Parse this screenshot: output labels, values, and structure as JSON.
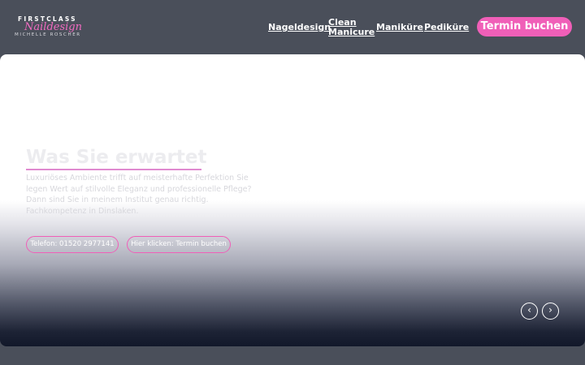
{
  "logo": {
    "line1": "FIRSTCLASS",
    "line2": "Naildesign",
    "line3": "MICHELLE ROSCHER"
  },
  "nav": {
    "items": [
      {
        "label": "Nageldesign"
      },
      {
        "label": "Clean Manicure"
      },
      {
        "label": "Maniküre"
      },
      {
        "label": "Pediküre"
      }
    ],
    "cta_label": "Termin buchen"
  },
  "hero": {
    "title": "Was Sie erwartet",
    "paragraphs": [
      "Luxuriöses Ambiente trifft auf meisterhafte Perfektion Sie legen Wert auf stilvolle Eleganz und professionelle Pflege?",
      "Dann sind Sie in meinem Institut genau richtig.",
      "Fachkompetenz in Dinslaken."
    ],
    "phone_button": "Telefon: 01520 2977141",
    "booking_button": "Hier klicken: Termin buchen",
    "prev_arrow": "‹",
    "next_arrow": "›"
  },
  "colors": {
    "accent": "#f05fb8",
    "header_bg": "#4a4f5a"
  }
}
